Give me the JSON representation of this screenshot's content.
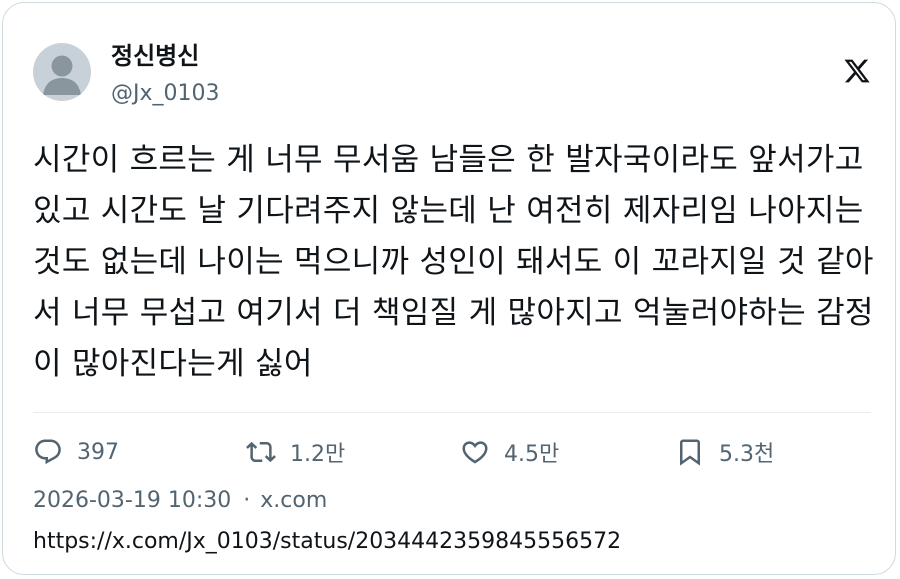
{
  "author": {
    "display_name": "정신병신",
    "handle": "@Jx_0103"
  },
  "tweet": {
    "text": "시간이 흐르는 게 너무 무서움 남들은 한 발자국이라도 앞서가고 있고 시간도 날 기다려주지 않는데 난 여전히 제자리임 나아지는 것도 없는데 나이는 먹으니까 성인이 돼서도 이 꼬라지일 것 같아서 너무 무섭고 여기서 더 책임질 게 많아지고 억눌러야하는 감정이 많아진다는게 싫어"
  },
  "actions": {
    "replies": "397",
    "retweets": "1.2만",
    "likes": "4.5만",
    "bookmarks": "5.3천"
  },
  "meta": {
    "timestamp": "2026-03-19 10:30",
    "separator": "·",
    "source": "x.com"
  },
  "link": {
    "url": "https://x.com/Jx_0103/status/2034442359845556572"
  },
  "icons": {
    "brand": "x-logo-icon",
    "reply": "reply-icon",
    "retweet": "retweet-icon",
    "like": "heart-icon",
    "bookmark": "bookmark-icon"
  },
  "colors": {
    "text": "#0f1419",
    "secondary": "#536471",
    "border": "#cfd9de",
    "avatar_bg": "#c9d1d8",
    "avatar_fg": "#8a969e"
  }
}
